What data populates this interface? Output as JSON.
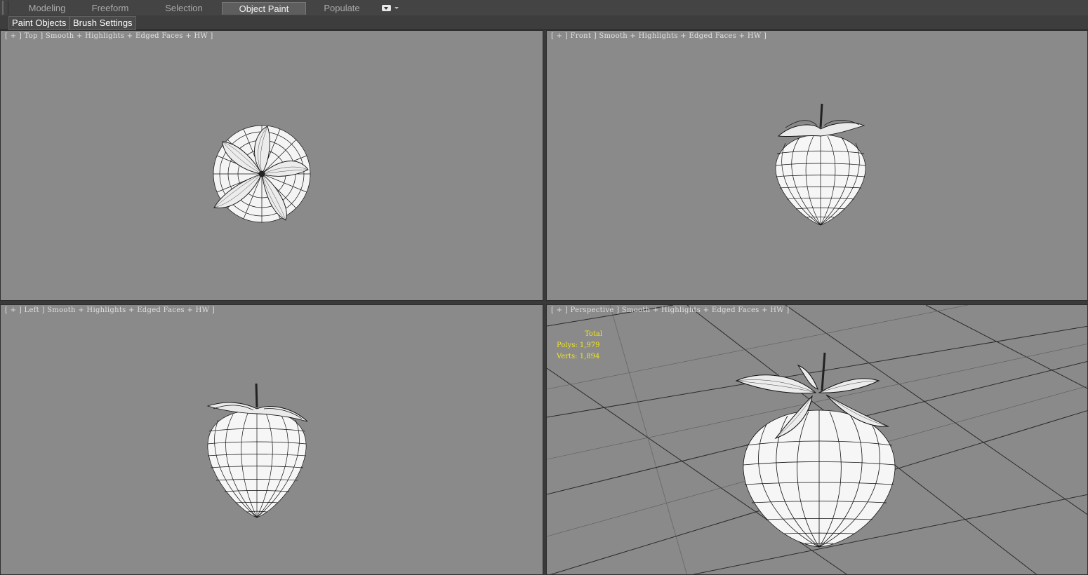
{
  "ribbon": {
    "tabs": [
      {
        "label": "Modeling",
        "active": false
      },
      {
        "label": "Freeform",
        "active": false
      },
      {
        "label": "Selection",
        "active": false
      },
      {
        "label": "Object Paint",
        "active": true
      },
      {
        "label": "Populate",
        "active": false
      }
    ],
    "dropdown_icon": "ribbon-options-icon"
  },
  "panel": {
    "paint_objects": "Paint Objects",
    "brush_settings": "Brush Settings"
  },
  "viewports": {
    "top": {
      "label": "[ + ] Top ] Smooth + Highlights + Edged Faces + HW ]"
    },
    "front": {
      "label": "[ + ] Front ] Smooth + Highlights + Edged Faces + HW ]"
    },
    "left": {
      "label": "[ + ] Left ] Smooth + Highlights + Edged Faces + HW ]"
    },
    "perspective": {
      "label": "[ + ] Perspective ] Smooth + Highlights + Edged Faces + HW ]",
      "stats": {
        "total_label": "Total",
        "polys": "Polys: 1,979",
        "verts": "Verts: 1,894"
      }
    }
  },
  "colors": {
    "viewport_bg": "#8a8a8a",
    "stats_text": "#f2e51d",
    "ui_bg": "#3a3a3a"
  }
}
